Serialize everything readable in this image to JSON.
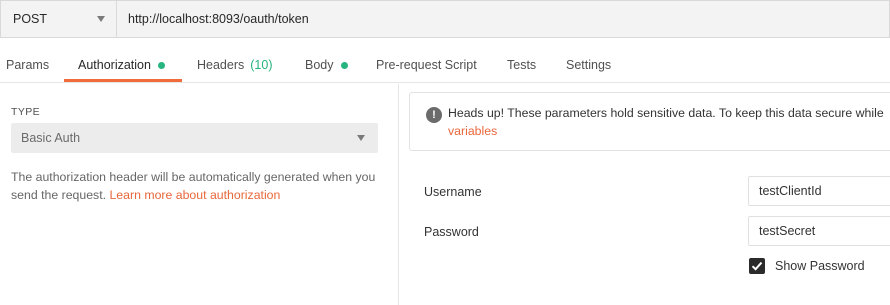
{
  "request": {
    "method": "POST",
    "url": "http://localhost:8093/oauth/token"
  },
  "tabs": [
    {
      "label": "Params"
    },
    {
      "label": "Authorization",
      "indicator": "green-dot"
    },
    {
      "label": "Headers",
      "count": "(10)"
    },
    {
      "label": "Body",
      "indicator": "green-dot"
    },
    {
      "label": "Pre-request Script"
    },
    {
      "label": "Tests"
    },
    {
      "label": "Settings"
    }
  ],
  "active_tab": "Authorization",
  "auth": {
    "type_label": "TYPE",
    "type_value": "Basic Auth",
    "description": "The authorization header will be automatically generated when you send the request.",
    "learn_more": "Learn more about authorization"
  },
  "notice": {
    "text": "Heads up! These parameters hold sensitive data. To keep this data secure while",
    "link": "variables"
  },
  "fields": {
    "username_label": "Username",
    "username_value": "testClientId",
    "password_label": "Password",
    "password_value": "testSecret",
    "show_password_label": "Show Password",
    "show_password_checked": true
  },
  "colors": {
    "accent": "#f26b3a",
    "link": "#e8673a",
    "indicator_green": "#26b47f"
  }
}
